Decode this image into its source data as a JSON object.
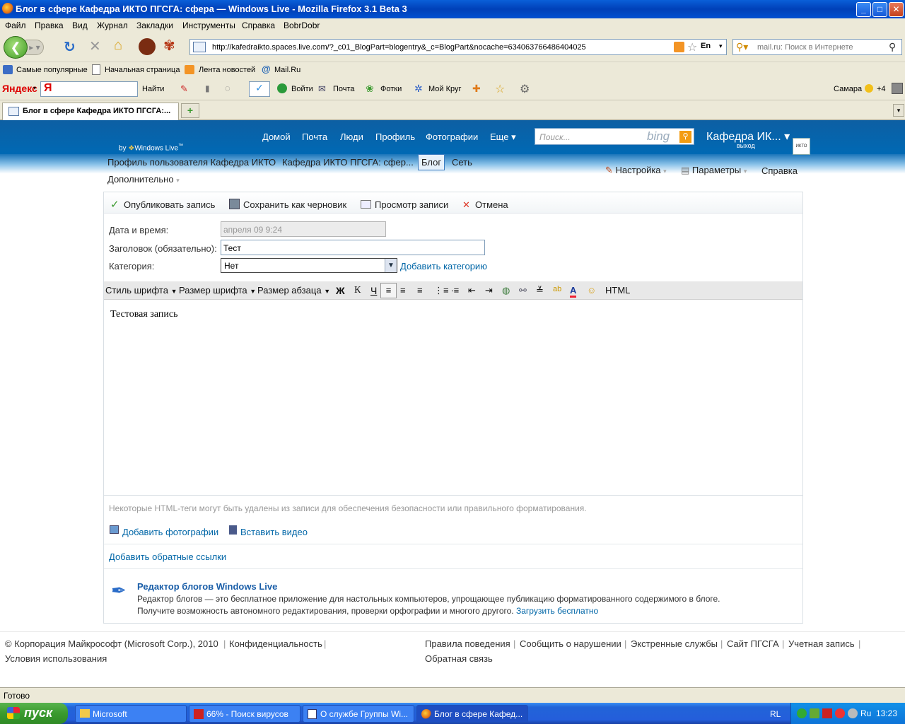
{
  "window": {
    "title": "Блог в сфере Кафедра ИКТО ПГСГА: сфера — Windows Live - Mozilla Firefox 3.1 Beta 3",
    "controls": {
      "minimize": "_",
      "maximize": "□",
      "close": "✕"
    }
  },
  "menu": [
    "Файл",
    "Правка",
    "Вид",
    "Журнал",
    "Закладки",
    "Инструменты",
    "Справка",
    "BobrDobr"
  ],
  "nav": {
    "url": "http://kafedraikto.spaces.live.com/?_c01_BlogPart=blogentry&_c=BlogPart&nocache=634063766486404025",
    "lang": "En",
    "search_placeholder": "mail.ru: Поиск в Интернете"
  },
  "bookmarks": [
    "Самые популярные",
    "Начальная страница",
    "Лента новостей",
    "Mail.Ru"
  ],
  "yandex_bar": {
    "logo": "Яндекс",
    "search_text": "Я",
    "find": "Найти",
    "login": "Войти",
    "mail": "Почта",
    "photos": "Фотки",
    "circle": "Мой Круг",
    "city": "Самара",
    "weather": "+4"
  },
  "tab": {
    "label": "Блог в сфере Кафедра ИКТО ПГСГА:...",
    "new_tab": "+"
  },
  "wl": {
    "by": "by",
    "brand": "Windows Live",
    "tm": "™",
    "nav": [
      "Домой",
      "Почта",
      "Люди",
      "Профиль",
      "Фотографии",
      "Еще ▾"
    ],
    "search_placeholder": "Поиск...",
    "bing": "bing",
    "user_name": "Кафедра ИК... ▾",
    "logout": "выход",
    "avatar_text": "ИКТО",
    "subnav": [
      "Профиль пользователя Кафедра ИКТО",
      "Кафедра ИКТО ПГСГА: сфер...",
      "Блог",
      "Сеть"
    ],
    "more": "Дополнительно",
    "settings": "Настройка",
    "params": "Параметры",
    "help": "Справка"
  },
  "actions": {
    "publish": "Опубликовать запись",
    "save_draft": "Сохранить как черновик",
    "preview": "Просмотр записи",
    "cancel": "Отмена"
  },
  "form": {
    "date_label": "Дата и время:",
    "date_value": "апреля 09 9:24",
    "title_label": "Заголовок (обязательно):",
    "title_value": "Тест",
    "category_label": "Категория:",
    "category_value": "Нет",
    "add_category": "Добавить категорию"
  },
  "format_bar": {
    "font_style": "Стиль шрифта",
    "font_size": "Размер шрифта",
    "para_size": "Размер абзаца",
    "bold": "Ж",
    "italic": "К",
    "underline": "Ч",
    "html": "HTML"
  },
  "editor": {
    "content": "Тестовая запись"
  },
  "note": "Некоторые HTML-теги могут быть удалены из записи для обеспечения безопасности или правильного форматирования.",
  "media": {
    "add_photos": "Добавить фотографии",
    "insert_video": "Вставить видео"
  },
  "trackbacks": "Добавить обратные ссылки",
  "promo": {
    "title": "Редактор блогов Windows Live",
    "line1": "Редактор блогов — это бесплатное приложение для настольных компьютеров, упрощающее публикацию форматированного содержимого в блоге.",
    "line2": "Получите возможность автономного редактирования, проверки орфографии и многого другого.",
    "download": "Загрузить бесплатно"
  },
  "footer": {
    "copyright": "© Корпорация Майкрософт (Microsoft Corp.), 2010",
    "privacy": "Конфиденциальность",
    "terms": "Условия использования",
    "rules": "Правила поведения",
    "report": "Сообщить о нарушении",
    "emergency": "Экстренные службы",
    "site": "Сайт ПГСГА",
    "account": "Учетная запись",
    "feedback": "Обратная связь"
  },
  "status": "Готово",
  "taskbar": {
    "start": "пуск",
    "items": [
      "Microsoft",
      "66% - Поиск вирусов",
      "О службе Группы Wi...",
      "Блог в сфере Кафед..."
    ],
    "lang": "RL",
    "tray_lang": "Ru",
    "clock": "13:23"
  },
  "colors": {
    "wl_blue": "#0d5fa3",
    "link": "#0066a7",
    "xp_title": "#0a5fd8",
    "start_green": "#3a9a2e"
  }
}
